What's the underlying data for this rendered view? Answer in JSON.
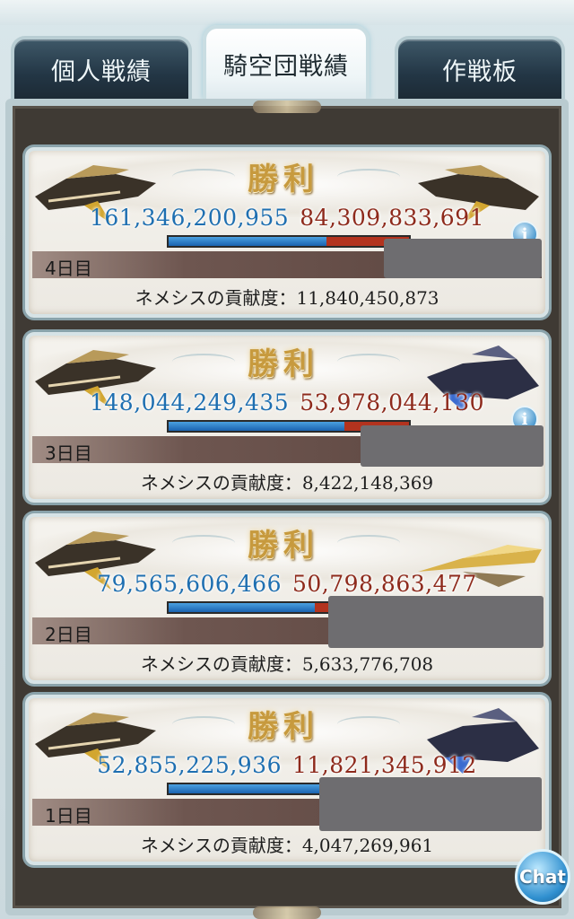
{
  "tabs": [
    {
      "label": "個人戦績",
      "active": false
    },
    {
      "label": "騎空団戦績",
      "active": true
    },
    {
      "label": "作戦板",
      "active": false
    }
  ],
  "results": [
    {
      "day": "4日目",
      "victory_label": "勝利",
      "our_score": "161,346,200,955",
      "enemy_score": "84,309,833,691",
      "our_share": 0.657,
      "contribution_label": "ネメシスの貢献度：",
      "contribution_value": "11,840,450,873"
    },
    {
      "day": "3日目",
      "victory_label": "勝利",
      "our_score": "148,044,249,435",
      "enemy_score": "53,978,044,130",
      "our_share": 0.733,
      "contribution_label": "ネメシスの貢献度：",
      "contribution_value": "8,422,148,369"
    },
    {
      "day": "2日目",
      "victory_label": "勝利",
      "our_score": "79,565,606,466",
      "enemy_score": "50,798,863,477",
      "our_share": 0.61,
      "contribution_label": "ネメシスの貢献度：",
      "contribution_value": "5,633,776,708"
    },
    {
      "day": "1日目",
      "victory_label": "勝利",
      "our_score": "52,855,225,936",
      "enemy_score": "11,821,345,912",
      "our_share": 0.817,
      "contribution_label": "ネメシスの貢献度：",
      "contribution_value": "4,047,269,961"
    }
  ],
  "info_icon": "i",
  "chat_button": {
    "label": "Chat"
  },
  "colors": {
    "our_bar": "#1b63b0",
    "enemy_bar": "#b3331e",
    "victory_gold": "#c79a3e",
    "panel_bg": "#3f3a34"
  }
}
